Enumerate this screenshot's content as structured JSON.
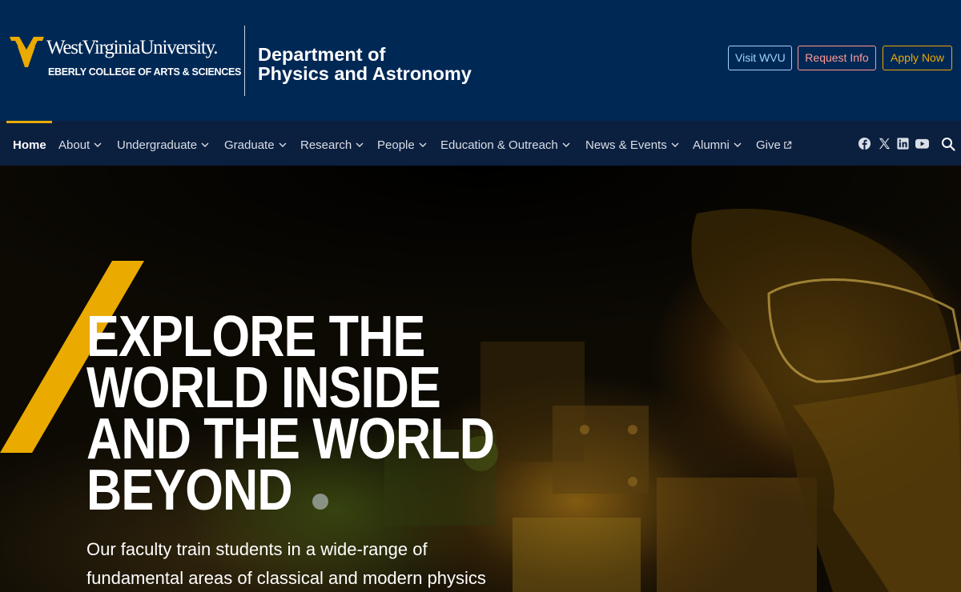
{
  "header": {
    "logo": {
      "wordmark": "WestVirginiaUniversity.",
      "college": "EBERLY COLLEGE OF ARTS & SCIENCES"
    },
    "department": {
      "line1": "Department of",
      "line2": "Physics and Astronomy"
    },
    "buttons": {
      "visit": "Visit WVU",
      "request": "Request Info",
      "apply": "Apply Now"
    },
    "colors": {
      "navy": "#002855",
      "gold": "#eaaa00"
    }
  },
  "nav": {
    "items": [
      {
        "label": "Home",
        "active": true
      },
      {
        "label": "About"
      },
      {
        "label": "Undergraduate"
      },
      {
        "label": "Graduate"
      },
      {
        "label": "Research"
      },
      {
        "label": "People"
      },
      {
        "label": "Education & Outreach"
      },
      {
        "label": "News & Events"
      },
      {
        "label": "Alumni"
      },
      {
        "label": "Give"
      }
    ],
    "social": [
      "facebook-icon",
      "x-icon",
      "linkedin-icon",
      "youtube-icon"
    ],
    "search_icon": "search-icon"
  },
  "hero": {
    "headline": [
      "EXPLORE THE",
      "WORLD INSIDE",
      "AND THE WORLD",
      "BEYOND"
    ],
    "subtext": [
      "Our faculty train students in a wide-range of",
      "fundamental areas of classical and modern physics"
    ]
  }
}
